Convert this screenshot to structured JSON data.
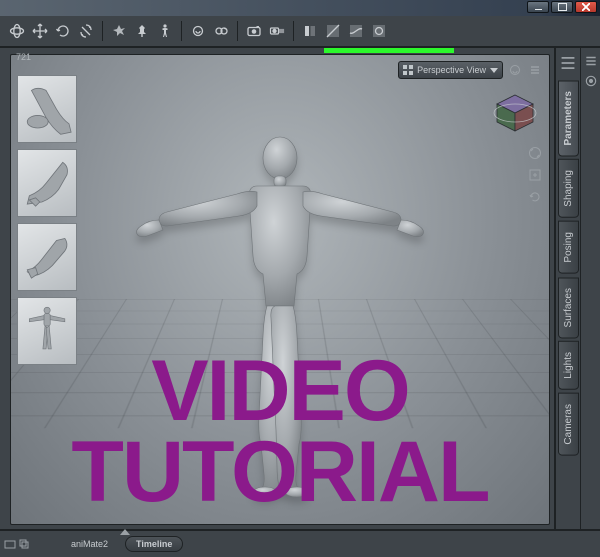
{
  "titlebar": {
    "minimize": "Minimize",
    "maximize": "Maximize",
    "close": "Close"
  },
  "toolbar": {
    "items": [
      {
        "name": "orbit-icon"
      },
      {
        "name": "move-icon"
      },
      {
        "name": "rotate-icon"
      },
      {
        "name": "scale-icon"
      },
      {
        "sep": true
      },
      {
        "name": "magnet-icon"
      },
      {
        "name": "pin-icon"
      },
      {
        "name": "figure-icon"
      },
      {
        "sep": true
      },
      {
        "name": "spot-render-icon"
      },
      {
        "name": "render-settings-icon"
      },
      {
        "sep": true
      },
      {
        "name": "camera-icon"
      },
      {
        "name": "cameras-icon"
      },
      {
        "sep": true
      },
      {
        "name": "pane-layout-icon"
      },
      {
        "name": "drawstyle-1-icon"
      },
      {
        "name": "drawstyle-2-icon"
      },
      {
        "name": "drawstyle-3-icon"
      }
    ]
  },
  "viewport": {
    "label": "721",
    "view_dropdown": "Perspective View",
    "thumbs": [
      {
        "name": "feet-pose"
      },
      {
        "name": "hand-pose-1"
      },
      {
        "name": "hand-pose-2"
      },
      {
        "name": "full-body-pose"
      }
    ]
  },
  "right_tabs": [
    "Parameters",
    "Shaping",
    "Posing",
    "Surfaces",
    "Lights",
    "Cameras"
  ],
  "right_tabs_active": 0,
  "bottom_tabs": {
    "animate": "aniMate2",
    "timeline": "Timeline"
  },
  "overlay": {
    "line1": "VIDEO",
    "line2": "TUTORIAL"
  }
}
